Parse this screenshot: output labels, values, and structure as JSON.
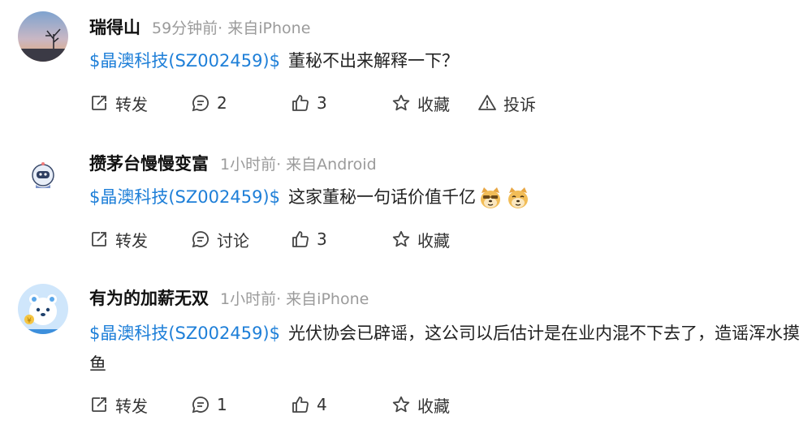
{
  "posts": [
    {
      "username": "瑞得山",
      "meta": "59分钟前· 来自iPhone",
      "stock": "$晶澳科技(SZ002459)$",
      "text": "董秘不出来解释一下？",
      "actions": {
        "forward": "转发",
        "comments": "2",
        "likes": "3",
        "favorite": "收藏",
        "report": "投诉"
      }
    },
    {
      "username": "攒茅台慢慢变富",
      "meta": "1小时前· 来自Android",
      "stock": "$晶澳科技(SZ002459)$",
      "text": "这家董秘一句话价值千亿",
      "actions": {
        "forward": "转发",
        "comments": "讨论",
        "likes": "3",
        "favorite": "收藏"
      }
    },
    {
      "username": "有为的加薪无双",
      "meta": "1小时前· 来自iPhone",
      "stock": "$晶澳科技(SZ002459)$",
      "text": "光伏协会已辟谣，这公司以后估计是在业内混不下去了，造谣浑水摸鱼",
      "actions": {
        "forward": "转发",
        "comments": "1",
        "likes": "4",
        "favorite": "收藏"
      }
    }
  ],
  "icons": {
    "forward": "share-box-icon",
    "comment": "comment-bubble-icon",
    "like": "thumbs-up-icon",
    "favorite": "star-outline-icon",
    "report": "warning-triangle-icon",
    "emoji": "doge-emoji-icon"
  },
  "colors": {
    "stock_link": "#1e7fd8",
    "meta": "#9b9b9b",
    "text": "#222222"
  }
}
